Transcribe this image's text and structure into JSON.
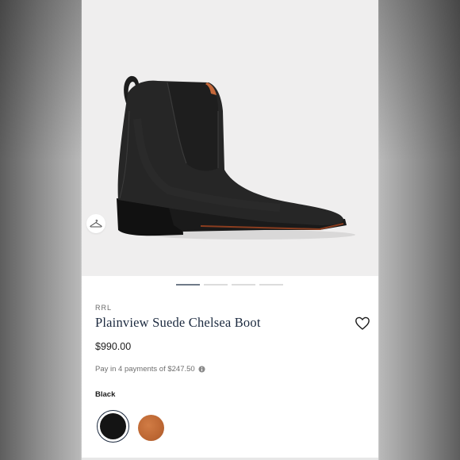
{
  "product": {
    "brand": "RRL",
    "title": "Plainview Suede Chelsea Boot",
    "price": "$990.00",
    "installments": "Pay in 4 payments of $247.50",
    "color_label": "Black"
  },
  "gallery": {
    "image_count": 4,
    "active_index": 0
  },
  "swatches": [
    {
      "name": "black",
      "color": "#141414",
      "selected": true
    },
    {
      "name": "brown",
      "color": "#c06a36",
      "selected": false
    }
  ],
  "icons": [
    "hanger-icon",
    "heart-icon",
    "info-icon"
  ],
  "colors": {
    "title_text": "#1c2a3f",
    "active_indicator": "#6f7a88",
    "hero_background": "#efeeee"
  }
}
